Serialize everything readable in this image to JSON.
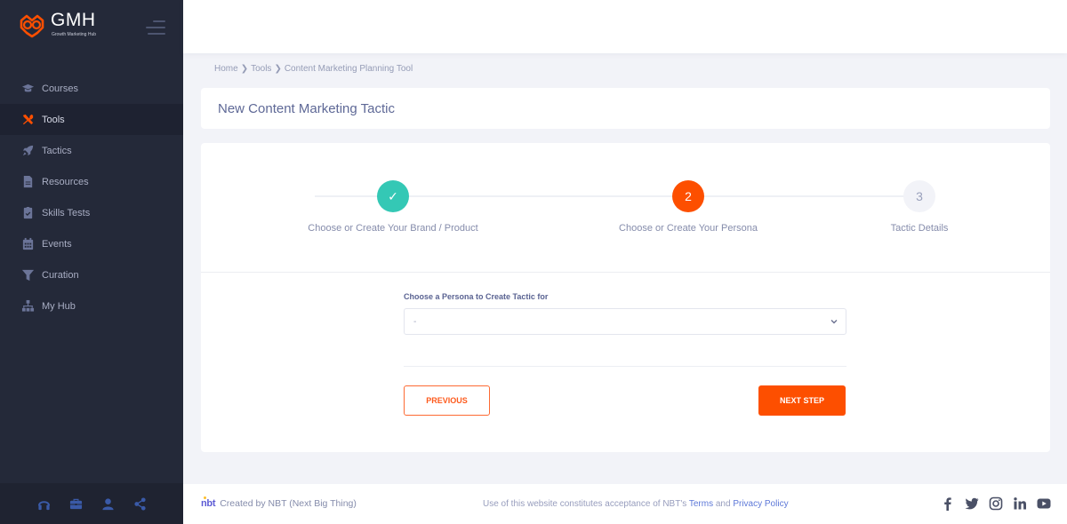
{
  "brand": {
    "name": "GMH",
    "tagline": "Growth Marketing Hub",
    "accent_color": "#fd4f00"
  },
  "sidebar": {
    "items": [
      {
        "label": "Courses",
        "icon": "graduation-cap-icon",
        "active": false
      },
      {
        "label": "Tools",
        "icon": "tools-icon",
        "active": true
      },
      {
        "label": "Tactics",
        "icon": "rocket-icon",
        "active": false
      },
      {
        "label": "Resources",
        "icon": "file-icon",
        "active": false
      },
      {
        "label": "Skills Tests",
        "icon": "clipboard-check-icon",
        "active": false
      },
      {
        "label": "Events",
        "icon": "calendar-icon",
        "active": false
      },
      {
        "label": "Curation",
        "icon": "filter-icon",
        "active": false
      },
      {
        "label": "My Hub",
        "icon": "sitemap-icon",
        "active": false
      }
    ],
    "footer_icons": [
      "headphones-icon",
      "briefcase-icon",
      "user-icon",
      "share-icon"
    ]
  },
  "breadcrumb": {
    "items": [
      "Home",
      "Tools",
      "Content Marketing Planning Tool"
    ],
    "separator": "❯"
  },
  "page": {
    "title": "New Content Marketing Tactic"
  },
  "stepper": {
    "steps": [
      {
        "number": "1",
        "label": "Choose or Create Your Brand / Product",
        "status": "done",
        "glyph": "✓"
      },
      {
        "number": "2",
        "label": "Choose or Create Your Persona",
        "status": "current",
        "glyph": "2"
      },
      {
        "number": "3",
        "label": "Tactic Details",
        "status": "todo",
        "glyph": "3"
      }
    ],
    "colors": {
      "done": "#34c8b5",
      "current": "#fd4f00",
      "todo": "#f2f3f8"
    }
  },
  "form": {
    "persona_label": "Choose a Persona to Create Tactic for",
    "persona_value": "-"
  },
  "buttons": {
    "previous": "PREVIOUS",
    "next": "NEXT STEP"
  },
  "footer": {
    "logo": "nbt",
    "created_by": "Created by  NBT (Next Big Thing)",
    "notice_prefix": "Use of this website constitutes acceptance of NBT's ",
    "terms_link": "Terms",
    "and": " and ",
    "privacy_link": "Privacy Policy",
    "social": [
      "facebook-icon",
      "twitter-icon",
      "instagram-icon",
      "linkedin-icon",
      "youtube-icon"
    ]
  }
}
